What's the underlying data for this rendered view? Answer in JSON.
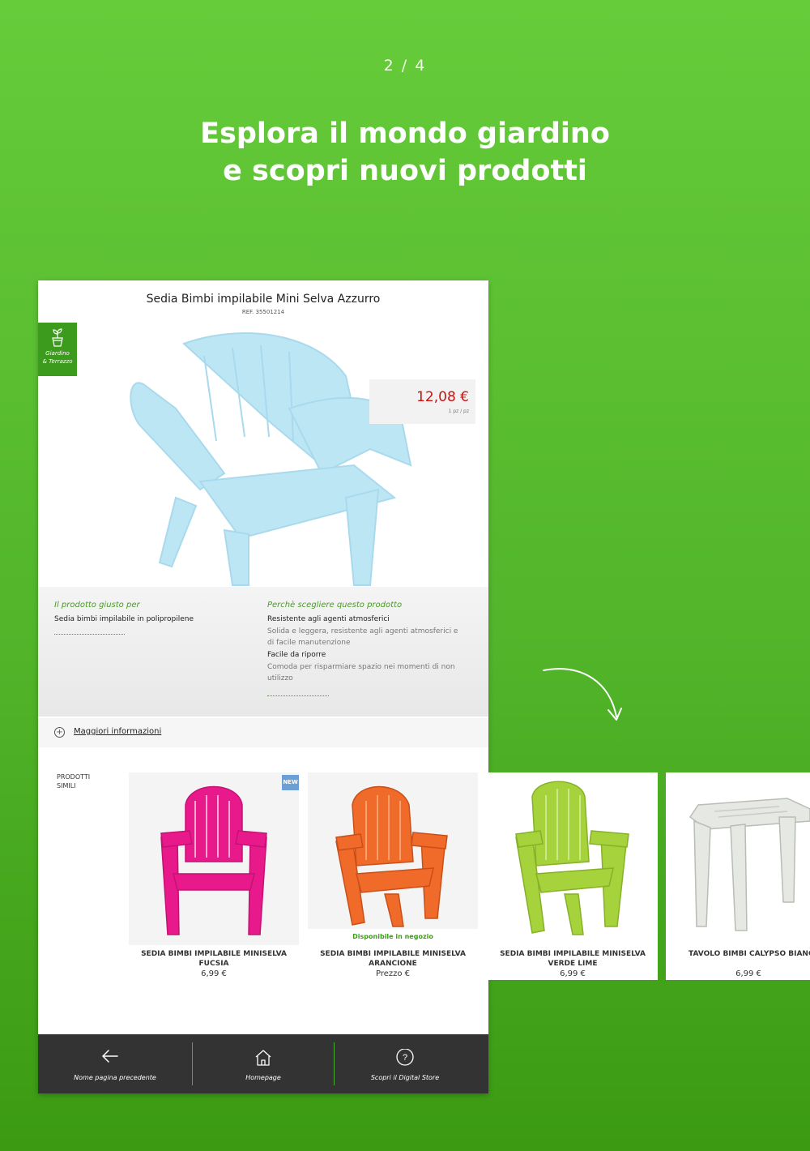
{
  "pager": "2 / 4",
  "headline": {
    "line1": "Esplora il mondo giardino",
    "line2": "e scopri nuovi prodotti"
  },
  "product": {
    "title": "Sedia Bimbi impilabile Mini Selva Azzurro",
    "ref": "REF. 35501214",
    "category_badge": {
      "line1": "Giardino",
      "line2": "& Terrazzo",
      "icon": "plant-pot-icon"
    },
    "price": "12,08 €",
    "price_unit": "1 pz / pz",
    "colors": {
      "price": "#cc1111",
      "accent": "#4a9a28"
    }
  },
  "info": {
    "left": {
      "heading": "Il prodotto giusto per",
      "text": "Sedia bimbi impilabile in polipropilene"
    },
    "right": {
      "heading": "Perchè scegliere questo prodotto",
      "features": [
        {
          "title": "Resistente agli agenti atmosferici",
          "line1": "Solida e leggera, resistente agli agenti atmosferici e",
          "line2": "di facile manutenzione"
        },
        {
          "title": "Facile da riporre",
          "line1": "Comoda per risparmiare spazio nei momenti di non",
          "line2": "utilizzo"
        }
      ]
    }
  },
  "more_info": "Maggiori informazioni",
  "similar": {
    "label_line1": "PRODOTTI",
    "label_line2": "SIMILI",
    "items": [
      {
        "name_line1": "SEDIA BIMBI IMPILABILE MINISELVA",
        "name_line2": "FUCSIA",
        "price": "6,99 €",
        "badge": "NEW",
        "color": "#e8198a"
      },
      {
        "name_line1": "SEDIA BIMBI IMPILABILE MINISELVA",
        "name_line2": "ARANCIONE",
        "price": "Prezzo €",
        "availability": "Disponibile in negozio",
        "color": "#f06a2a"
      },
      {
        "name_line1": "SEDIA BIMBI IMPILABILE MINISELVA",
        "name_line2": "VERDE LIME",
        "price": "6,99 €",
        "color": "#a6d23c"
      },
      {
        "name_line1": "TAVOLO BIMBI CALYPSO BIANCO",
        "name_line2": "",
        "price": "6,99 €",
        "color": "#e8ebe6"
      }
    ]
  },
  "nav": [
    {
      "label": "Nome pagina precedente",
      "icon": "back-arrow-icon"
    },
    {
      "label": "Homepage",
      "icon": "home-icon"
    },
    {
      "label": "Scopri il Digital Store",
      "icon": "help-icon"
    }
  ]
}
